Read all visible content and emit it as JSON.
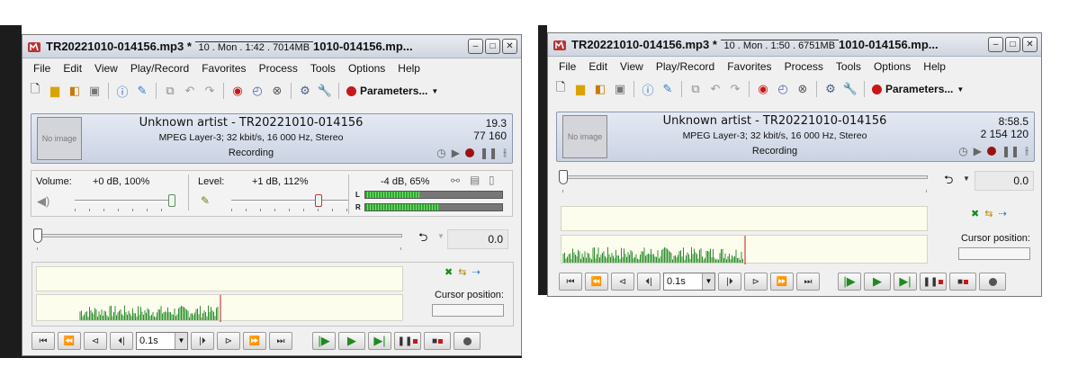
{
  "colors": {
    "wave": "#2d8f2d",
    "wave_bg": "#fdfdee",
    "rec": "#c81818",
    "meter": "#2ea82e"
  },
  "left_window": {
    "title": "TR20221010-014156.mp3 * ",
    "title_overlay": "10 . Mon . 1:42 . 7014MB",
    "title_tail": "1010-014156.mp...",
    "menu": [
      "File",
      "Edit",
      "View",
      "Play/Record",
      "Favorites",
      "Process",
      "Tools",
      "Options",
      "Help"
    ],
    "toolbar": {
      "params_label": "Parameters..."
    },
    "info": {
      "no_image": "No image",
      "title": "Unknown artist - TR20221010-014156",
      "format": "MPEG Layer-3; 32 kbit/s, 16 000 Hz, Stereo",
      "status": "Recording",
      "time": "19.3",
      "size": "77 160"
    },
    "volume": {
      "label": "Volume:",
      "value": "+0 dB, 100%",
      "level": 1.0
    },
    "level": {
      "label": "Level:",
      "value": "+1 dB, 112%",
      "level": 0.75
    },
    "meter": {
      "value": "-4 dB, 65%",
      "l_label": "L",
      "r_label": "R",
      "l_fill": 0.4,
      "r_fill": 0.54
    },
    "position_value": "0.0",
    "cursor_label": "Cursor position:",
    "step": "0.1s"
  },
  "right_window": {
    "title": "TR20221010-014156.mp3 * ",
    "title_overlay": "10 . Mon . 1:50 . 6751MB",
    "title_tail": "1010-014156.mp...",
    "menu": [
      "File",
      "Edit",
      "View",
      "Play/Record",
      "Favorites",
      "Process",
      "Tools",
      "Options",
      "Help"
    ],
    "toolbar": {
      "params_label": "Parameters..."
    },
    "info": {
      "no_image": "No image",
      "title": "Unknown artist - TR20221010-014156",
      "format": "MPEG Layer-3; 32 kbit/s, 16 000 Hz, Stereo",
      "status": "Recording",
      "time": "8:58.5",
      "size": "2 154 120"
    },
    "position_value": "0.0",
    "cursor_label": "Cursor position:",
    "step": "0.1s"
  }
}
